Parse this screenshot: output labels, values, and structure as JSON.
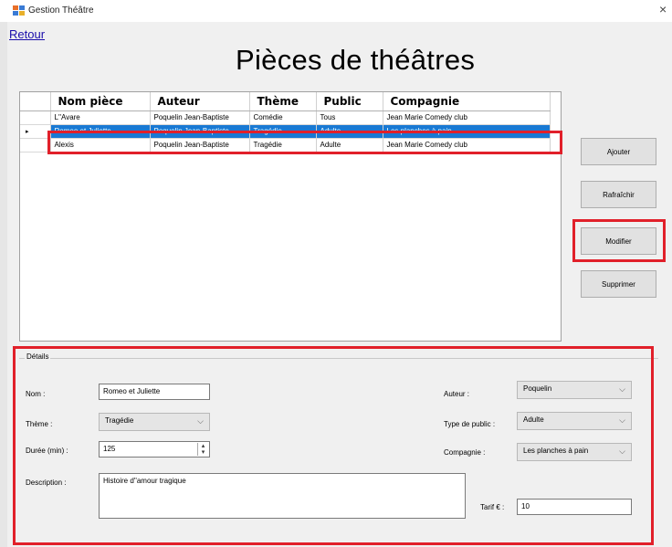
{
  "window": {
    "title": "Gestion Théâtre",
    "close": "×"
  },
  "nav": {
    "back_link": "Retour"
  },
  "page": {
    "title": "Pièces de théâtres"
  },
  "grid": {
    "columns": [
      "Nom pièce",
      "Auteur",
      "Thème",
      "Public",
      "Compagnie"
    ],
    "rows": [
      {
        "nom": "L''Avare",
        "auteur": "Poquelin Jean-Baptiste",
        "theme": "Comédie",
        "public": "Tous",
        "compagnie": "Jean Marie Comedy club"
      },
      {
        "nom": "Romeo et Juliette",
        "auteur": "Poquelin Jean-Baptiste",
        "theme": "Tragédie",
        "public": "Adulte",
        "compagnie": "Les planches à pain"
      },
      {
        "nom": "Alexis",
        "auteur": "Poquelin Jean-Baptiste",
        "theme": "Tragédie",
        "public": "Adulte",
        "compagnie": "Jean Marie Comedy club"
      }
    ],
    "selected_row_marker": "▸"
  },
  "actions": {
    "add": "Ajouter",
    "refresh": "Rafraîchir",
    "edit": "Modifier",
    "delete": "Supprimer"
  },
  "details": {
    "group_title": "Détails",
    "nom_label": "Nom :",
    "nom_value": "Romeo et Juliette",
    "theme_label": "Thème :",
    "theme_value": "Tragédie",
    "duree_label": "Durée (min) :",
    "duree_value": "125",
    "description_label": "Description :",
    "description_value": "Histoire d''amour tragique",
    "auteur_label": "Auteur :",
    "auteur_value": "Poquelin",
    "public_label": "Type de public :",
    "public_value": "Adulte",
    "compagnie_label": "Compagnie :",
    "compagnie_value": "Les planches à pain",
    "tarif_label": "Tarif € :",
    "tarif_value": "10"
  },
  "colors": {
    "highlight": "#e1202a",
    "selection": "#1979d3",
    "link": "#1a0dab"
  },
  "icons": [
    "app-icon",
    "close-icon",
    "row-selector-icon",
    "chevron-down-icon",
    "spinner-icon"
  ]
}
